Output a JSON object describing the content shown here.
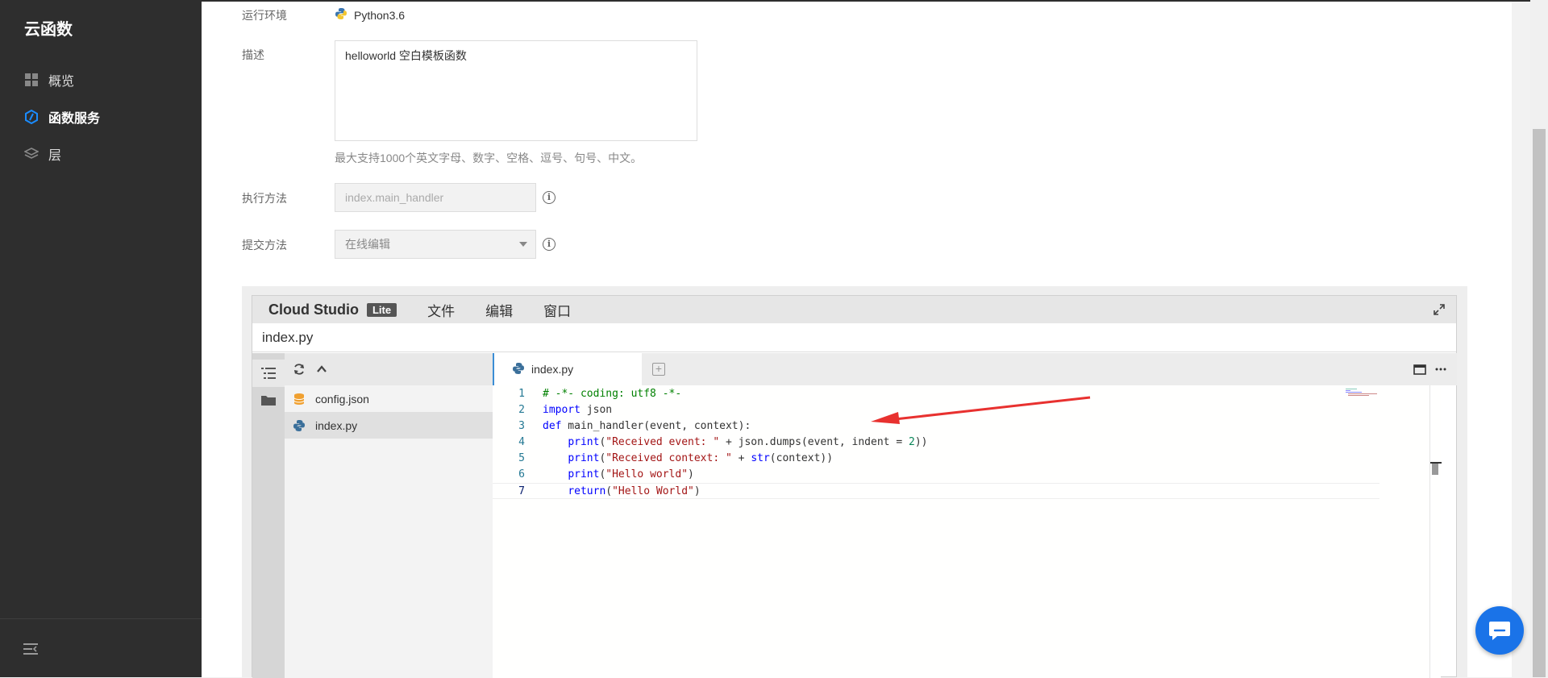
{
  "sidebar": {
    "brand": "云函数",
    "items": [
      {
        "label": "概览",
        "icon": "dashboard-icon"
      },
      {
        "label": "函数服务",
        "icon": "function-service-icon",
        "active": true
      },
      {
        "label": "层",
        "icon": "layers-icon"
      }
    ]
  },
  "form": {
    "runtime_label": "运行环境",
    "runtime_value": "Python3.6",
    "description_label": "描述",
    "description_value": "helloworld 空白模板函数",
    "description_hint": "最大支持1000个英文字母、数字、空格、逗号、句号、中文。",
    "handler_label": "执行方法",
    "handler_placeholder": "index.main_handler",
    "submit_label": "提交方法",
    "submit_value": "在线编辑"
  },
  "ide": {
    "brand": "Cloud Studio",
    "brand_badge": "Lite",
    "menu": [
      "文件",
      "编辑",
      "窗口"
    ],
    "title": "index.py",
    "files": [
      {
        "name": "config.json",
        "icon": "database-file-icon"
      },
      {
        "name": "index.py",
        "icon": "python-file-icon",
        "selected": true
      }
    ],
    "active_tab": "index.py",
    "code_lines": [
      {
        "n": "1",
        "text": "# -*- coding: utf8 -*-"
      },
      {
        "n": "2",
        "text": "import json"
      },
      {
        "n": "3",
        "text": "def main_handler(event, context):"
      },
      {
        "n": "4",
        "text": "    print(\"Received event: \" + json.dumps(event, indent = 2))"
      },
      {
        "n": "5",
        "text": "    print(\"Received context: \" + str(context))"
      },
      {
        "n": "6",
        "text": "    print(\"Hello world\")"
      },
      {
        "n": "7",
        "text": "    return(\"Hello World\")"
      }
    ]
  },
  "colors": {
    "sidebar_bg": "#2e2e2e",
    "accent": "#1a73e8",
    "annotation_arrow": "#e8312f"
  }
}
